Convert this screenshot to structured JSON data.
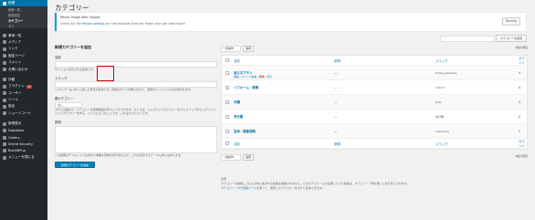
{
  "sidebar": {
    "items": [
      {
        "label": "投稿",
        "icon": "pin-icon",
        "active": true
      },
      {
        "label": "投稿一覧",
        "sub": true
      },
      {
        "label": "新規追加",
        "sub": true
      },
      {
        "label": "カテゴリー",
        "sub": true,
        "current": true
      },
      {
        "label": "タグ",
        "sub": true
      },
      {
        "label": "事例一覧",
        "icon": "thumbtack-icon"
      },
      {
        "label": "メディア",
        "icon": "media-icon"
      },
      {
        "label": "リンク",
        "icon": "link-icon"
      },
      {
        "label": "固定ページ",
        "icon": "page-icon"
      },
      {
        "label": "コメント",
        "icon": "comment-icon"
      },
      {
        "label": "お問い合わせ",
        "icon": "mail-icon"
      },
      {
        "label": "外観",
        "icon": "brush-icon"
      },
      {
        "label": "プラグイン",
        "icon": "plugin-icon",
        "badge": "5"
      },
      {
        "label": "ユーザー",
        "icon": "user-icon"
      },
      {
        "label": "ツール",
        "icon": "wrench-icon"
      },
      {
        "label": "設定",
        "icon": "settings-icon"
      },
      {
        "label": "ショートコード",
        "icon": "shortcode-icon"
      },
      {
        "label": "新規表示",
        "icon": "new-icon"
      },
      {
        "label": "Database",
        "icon": "database-icon"
      },
      {
        "label": "Gallery",
        "icon": "gallery-icon"
      },
      {
        "label": "Shield Security",
        "icon": "shield-icon"
      },
      {
        "label": "BackWPup",
        "icon": "backup-icon"
      },
      {
        "label": "メニューを閉じる",
        "icon": "collapse-icon"
      }
    ]
  },
  "header": {
    "title": "カテゴリー"
  },
  "notice": {
    "title": "Resize Image After Upload",
    "text_before": "Check out the",
    "link": "Resize settings",
    "text_after": "for new features that can make your site load faster!",
    "dismiss": "Dismiss"
  },
  "search": {
    "button": "カテゴリーを検索"
  },
  "form": {
    "heading": "新規カテゴリーを追加",
    "name_label": "名前",
    "name_desc": "サイト上に表示される名前です。",
    "slug_label": "スラッグ",
    "slug_desc": "\"スラッグ\" は URL に適した形式の名前です。通常はすべて半角小文字で、英数字とハイフンのみが使われます。",
    "parent_label": "親カテゴリー",
    "parent_value": "なし",
    "parent_desc": "タグとは異なり、カテゴリーは階層構造を持つことができます。たとえば、ジャズというカテゴリーの下にビバップやビッグバンドというカテゴリーを作る、といったようなことです。これはオプションです。",
    "desc_label": "説明",
    "desc_desc": "この説明はデフォルトではあまり重要な意味を持ちませんが、これを表示するテーマも中にはあります。",
    "submit": "新規カテゴリーを追加"
  },
  "bulk": {
    "select": "一括操作",
    "apply": "適用",
    "count": "5個の項目"
  },
  "table": {
    "columns": {
      "name": "名前",
      "description": "説明",
      "slug": "スラッグ",
      "count": "カウント"
    },
    "rows": [
      {
        "name": "省エネプラン",
        "description": "—",
        "slug": "home_planning",
        "count": "4"
      },
      {
        "name": "リフォーム・新築",
        "description": "—",
        "slug": "reform",
        "count": "4"
      },
      {
        "name": "外構",
        "description": "—",
        "slug": "fudo",
        "count": "4"
      },
      {
        "name": "未分類",
        "description": "—",
        "slug": "未分類",
        "count": "0"
      },
      {
        "name": "生命・損害保険",
        "description": "—",
        "slug": "insurance",
        "count": "2"
      }
    ],
    "row_actions": {
      "edit": "編集",
      "quick": "クイック編集",
      "delete": "削除",
      "view": "表示"
    }
  },
  "notes": {
    "heading": "注意:",
    "text1": "カテゴリーを削除してもその中に含まれる投稿は削除されません。そのカテゴリーにのみ属していた投稿は、カテゴリー「未分類」に割り当てられます。",
    "link": "カテゴリー・タグ変換ツール",
    "text2": "を使って、選択したカテゴリーをタグに変換できます。"
  }
}
